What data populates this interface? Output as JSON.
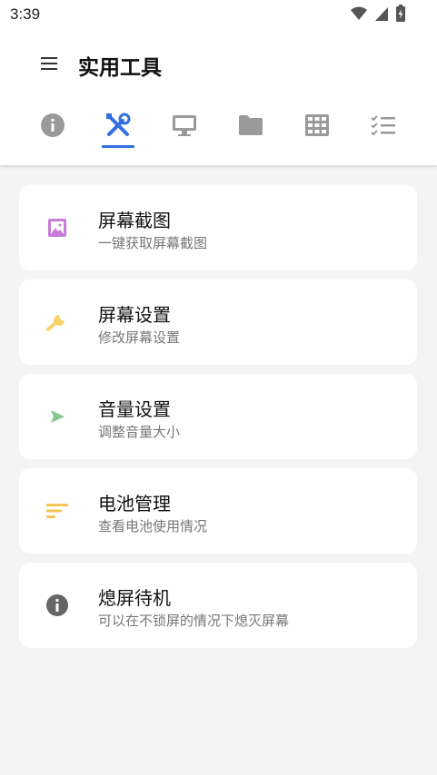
{
  "status_bar": {
    "time": "3:39",
    "icons": [
      "wifi-icon",
      "cell-signal-icon",
      "battery-charging-icon"
    ]
  },
  "app_bar": {
    "menu_icon": "hamburger-menu-icon",
    "title": "实用工具"
  },
  "tabs": [
    {
      "icon": "info-icon",
      "selected": false
    },
    {
      "icon": "tools-icon",
      "selected": true
    },
    {
      "icon": "monitor-icon",
      "selected": false
    },
    {
      "icon": "folder-icon",
      "selected": false
    },
    {
      "icon": "grid-icon",
      "selected": false
    },
    {
      "icon": "checklist-icon",
      "selected": false
    }
  ],
  "accent_color": "#2f6fde",
  "tools": [
    {
      "title": "屏幕截图",
      "subtitle": "一键获取屏幕截图",
      "icon": "image-icon",
      "icon_color": "#c77bd6"
    },
    {
      "title": "屏幕设置",
      "subtitle": "修改屏幕设置",
      "icon": "wrench-icon",
      "icon_color": "#f7d36a"
    },
    {
      "title": "音量设置",
      "subtitle": "调整音量大小",
      "icon": "play-arrow-icon",
      "icon_color": "#86c78f"
    },
    {
      "title": "电池管理",
      "subtitle": "查看电池使用情况",
      "icon": "sort-lines-icon",
      "icon_color": "#f5c654"
    },
    {
      "title": "熄屏待机",
      "subtitle": "可以在不锁屏的情况下熄灭屏幕",
      "icon": "info-icon",
      "icon_color": "#666666"
    }
  ]
}
